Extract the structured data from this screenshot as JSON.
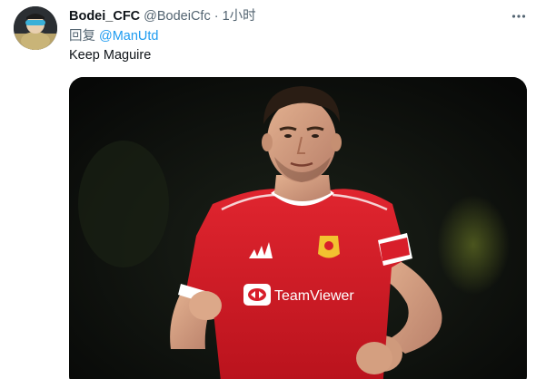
{
  "tweet": {
    "author": {
      "display_name": "Bodei_CFC",
      "handle": "@BodeiCfc",
      "separator": "·",
      "time": "1小时"
    },
    "reply": {
      "prefix": "回复",
      "mention": "@ManUtd"
    },
    "text": "Keep Maguire",
    "media": {
      "jersey_sponsor": "TeamViewer"
    },
    "icons": {
      "more": "more-horizontal-icon",
      "avatar": "avatar"
    },
    "colors": {
      "link": "#1d9bf0",
      "secondary_text": "#536471",
      "primary_text": "#0f1419",
      "jersey_red": "#d81e2a"
    }
  }
}
